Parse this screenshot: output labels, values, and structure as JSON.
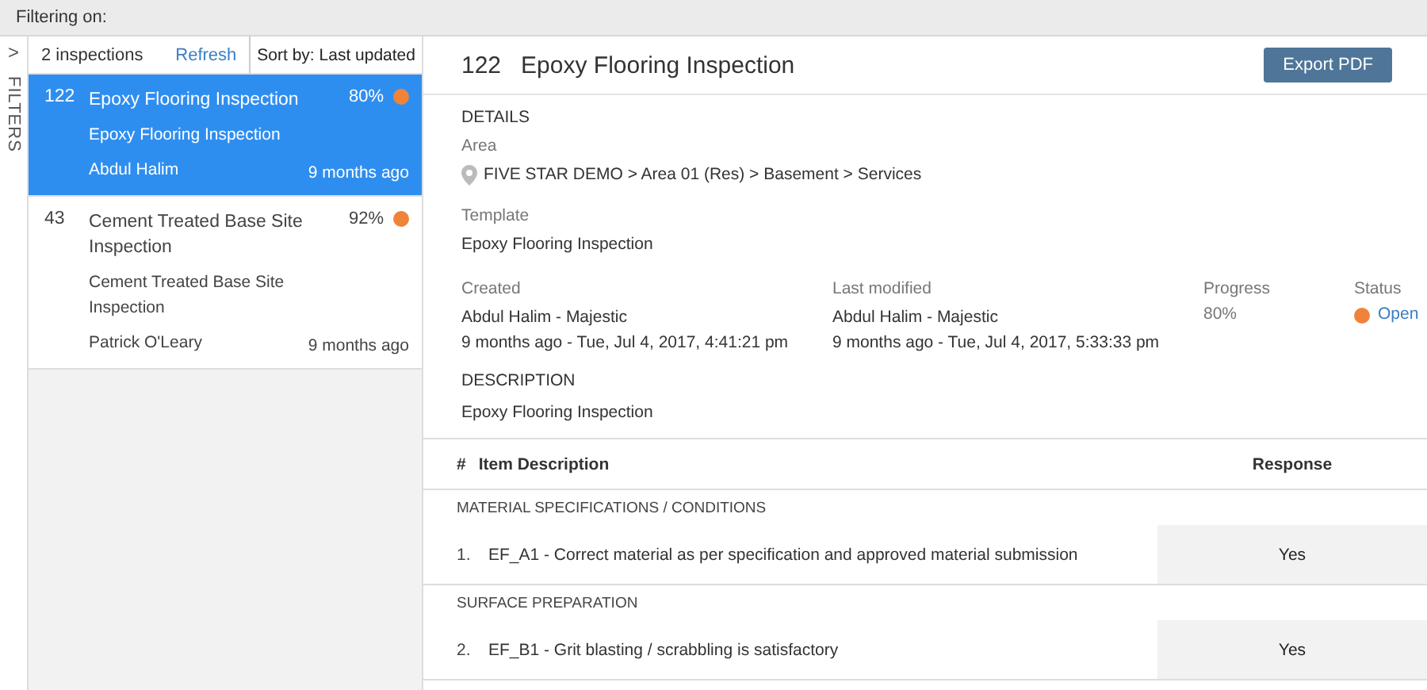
{
  "filter_bar": {
    "label": "Filtering on:"
  },
  "filters_rail": {
    "label": "FILTERS",
    "chevron": ">"
  },
  "list_header": {
    "count": "2 inspections",
    "refresh": "Refresh",
    "sort": "Sort by: Last updated"
  },
  "inspections": [
    {
      "number": "122",
      "title": "Epoxy Flooring Inspection",
      "progress": "80%",
      "color": "#f0833a",
      "template": "Epoxy Flooring Inspection",
      "inspector": "Abdul Halim",
      "updated": "9 months ago",
      "selected": true
    },
    {
      "number": "43",
      "title": "Cement Treated Base Site Inspection",
      "progress": "92%",
      "color": "#f0833a",
      "template": "Cement Treated Base Site Inspection",
      "inspector": "Patrick O'Leary",
      "updated": "9 months ago",
      "selected": false
    }
  ],
  "detail": {
    "number": "122",
    "title": "Epoxy Flooring Inspection",
    "export_button": "Export PDF",
    "details_heading": "DETAILS",
    "area_label": "Area",
    "area": "FIVE STAR DEMO > Area 01 (Res) > Basement > Services",
    "template_label": "Template",
    "template": "Epoxy Flooring Inspection",
    "created_label": "Created",
    "created_by": "Abdul Halim - Majestic",
    "created_at": "9 months ago - Tue, Jul 4, 2017, 4:41:21 pm",
    "modified_label": "Last modified",
    "modified_by": "Abdul Halim - Majestic",
    "modified_at": "9 months ago - Tue, Jul 4, 2017, 5:33:33 pm",
    "progress_label": "Progress",
    "progress": "80%",
    "status_label": "Status",
    "status": {
      "label": "Open",
      "color": "#f0833a"
    },
    "description_heading": "DESCRIPTION",
    "description": "Epoxy Flooring Inspection"
  },
  "table": {
    "columns": [
      "#",
      "Item Description",
      "Response"
    ],
    "sections": [
      {
        "heading": "MATERIAL SPECIFICATIONS / CONDITIONS",
        "rows": [
          {
            "index": "1.",
            "description": "EF_A1 - Correct material as per specification and approved material submission",
            "response": "Yes"
          }
        ]
      },
      {
        "heading": "SURFACE PREPARATION",
        "rows": [
          {
            "index": "2.",
            "description": "EF_B1 - Grit blasting / scrabbling is satisfactory",
            "response": "Yes"
          }
        ]
      }
    ]
  }
}
